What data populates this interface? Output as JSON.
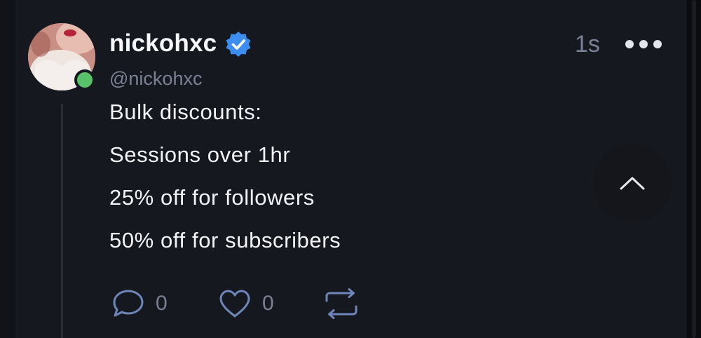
{
  "post": {
    "author": {
      "display_name": "nickohxc",
      "handle": "@nickohxc",
      "verified": true,
      "online": true
    },
    "timestamp": "1s",
    "lines": [
      "Bulk discounts:",
      "Sessions over 1hr",
      "25% off for followers",
      "50% off for subscribers"
    ],
    "actions": {
      "reply_count": "0",
      "like_count": "0"
    }
  },
  "icons": {
    "verified": "verified-badge-icon",
    "more": "more-horizontal-icon",
    "scroll_top": "chevron-up-icon",
    "reply": "speech-bubble-icon",
    "like": "heart-icon",
    "repost": "repost-icon"
  },
  "colors": {
    "background": "#121318",
    "card": "#16181f",
    "verified_blue": "#3b8ef0",
    "online_green": "#57c26a",
    "muted_text": "#7b8195",
    "icon_blue": "#6f86b8"
  }
}
